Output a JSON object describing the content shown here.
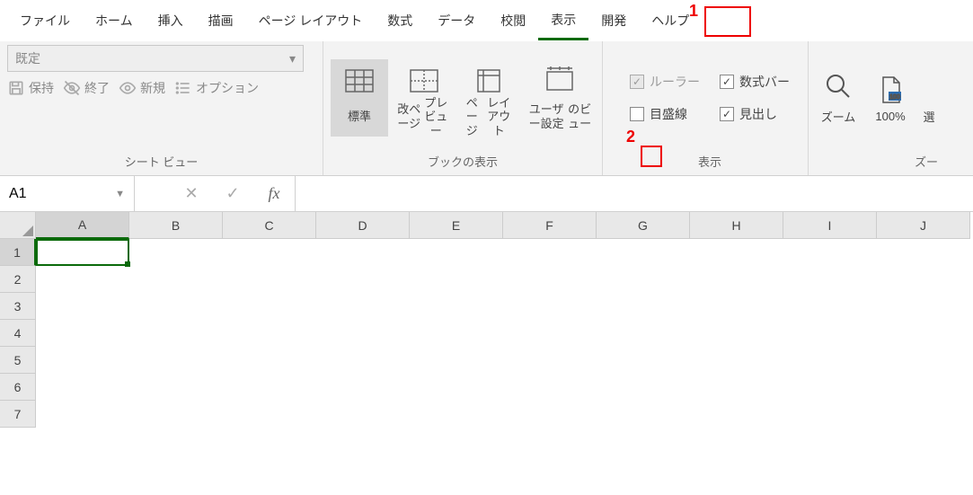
{
  "tabs": {
    "file": "ファイル",
    "home": "ホーム",
    "insert": "挿入",
    "draw": "描画",
    "pagelayout": "ページ レイアウト",
    "formulas": "数式",
    "data": "データ",
    "review": "校閲",
    "view": "表示",
    "developer": "開発",
    "help": "ヘルプ"
  },
  "annotations": {
    "one": "1",
    "two": "2"
  },
  "sheetview": {
    "dropdown": "既定",
    "keep": "保持",
    "exit": "終了",
    "new": "新規",
    "options": "オプション",
    "grouplabel": "シート ビュー"
  },
  "wbviews": {
    "normal": "標準",
    "pagebreak_l1": "改ページ",
    "pagebreak_l2": "プレビュー",
    "pagelayout_l1": "ページ",
    "pagelayout_l2": "レイアウト",
    "custom_l1": "ユーザー設定",
    "custom_l2": "のビュー",
    "grouplabel": "ブックの表示"
  },
  "show": {
    "ruler": "ルーラー",
    "formulabar": "数式バー",
    "gridlines": "目盛線",
    "headings": "見出し",
    "grouplabel": "表示"
  },
  "zoom": {
    "zoom": "ズーム",
    "hundred": "100%",
    "sel": "選",
    "grouplabel": "ズー"
  },
  "namebox": {
    "value": "A1"
  },
  "fbar": {
    "cancel": "✕",
    "enter": "✓",
    "fx": "fx"
  },
  "cols": [
    "A",
    "B",
    "C",
    "D",
    "E",
    "F",
    "G",
    "H",
    "I",
    "J"
  ],
  "rows": [
    "1",
    "2",
    "3",
    "4",
    "5",
    "6",
    "7"
  ]
}
